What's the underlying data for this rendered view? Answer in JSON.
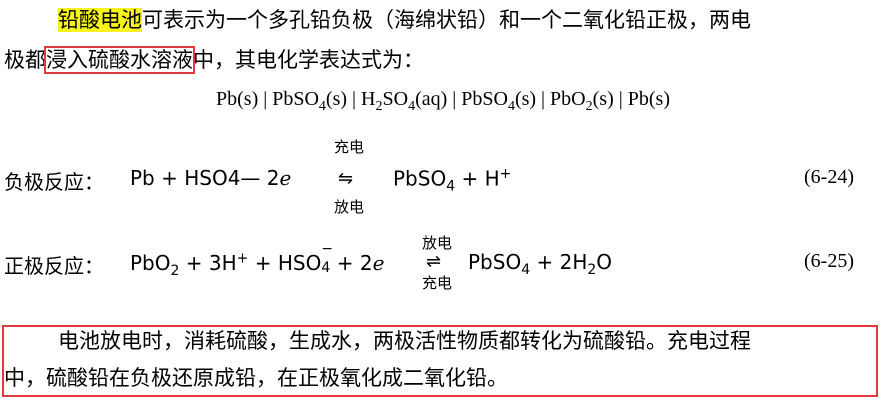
{
  "intro": {
    "highlight": "铅酸电池",
    "line1_rest": "可表示为一个多孔铅负极（海绵状铅）和一个二氧化铅正极，两电",
    "line2_a": "极都",
    "line2_boxed": "浸入硫酸水溶液",
    "line2_b": "中，其电化学表达式为："
  },
  "cell_notation": {
    "pb1": "Pb(s) | PbSO",
    "sub4a": "4",
    "mid1": "(s) | H",
    "sub2a": "2",
    "so4": "SO",
    "sub4b": "4",
    "mid2": "(aq) | PbSO",
    "sub4c": "4",
    "mid3": "(s) | PbO",
    "sub2b": "2",
    "end": "(s) | Pb(s)"
  },
  "eq_negative": {
    "label": "负极反应：",
    "lhs": "Pb  + HSO4— 2",
    "e": "e",
    "charge": "充电",
    "discharge": "放电",
    "rhs_a": "PbSO",
    "rhs_sub": "4",
    "rhs_b": " + H",
    "rhs_sup": "+",
    "number": "(6-24)"
  },
  "eq_positive": {
    "label": "正极反应：",
    "a": "PbO",
    "a_sub": "2",
    "b": " + 3H",
    "b_sup": "+",
    "c": " + HSO",
    "c_sub": "4",
    "c_sup": "−",
    "d": " + 2",
    "e": "e",
    "discharge": "放电",
    "charge": "充电",
    "rhs_a": "PbSO",
    "rhs_sub": "4",
    "rhs_b": " + 2H",
    "rhs_sub2": "2",
    "rhs_c": "O",
    "number": "(6-25)"
  },
  "summary": {
    "line1": "电池放电时，消耗硫酸，生成水，两极活性物质都转化为硫酸铅。充电过程",
    "line2": "中，硫酸铅在负极还原成铅，在正极氧化成二氧化铅。"
  },
  "colors": {
    "highlight": "#f7f31c",
    "box": "#e0383e"
  }
}
